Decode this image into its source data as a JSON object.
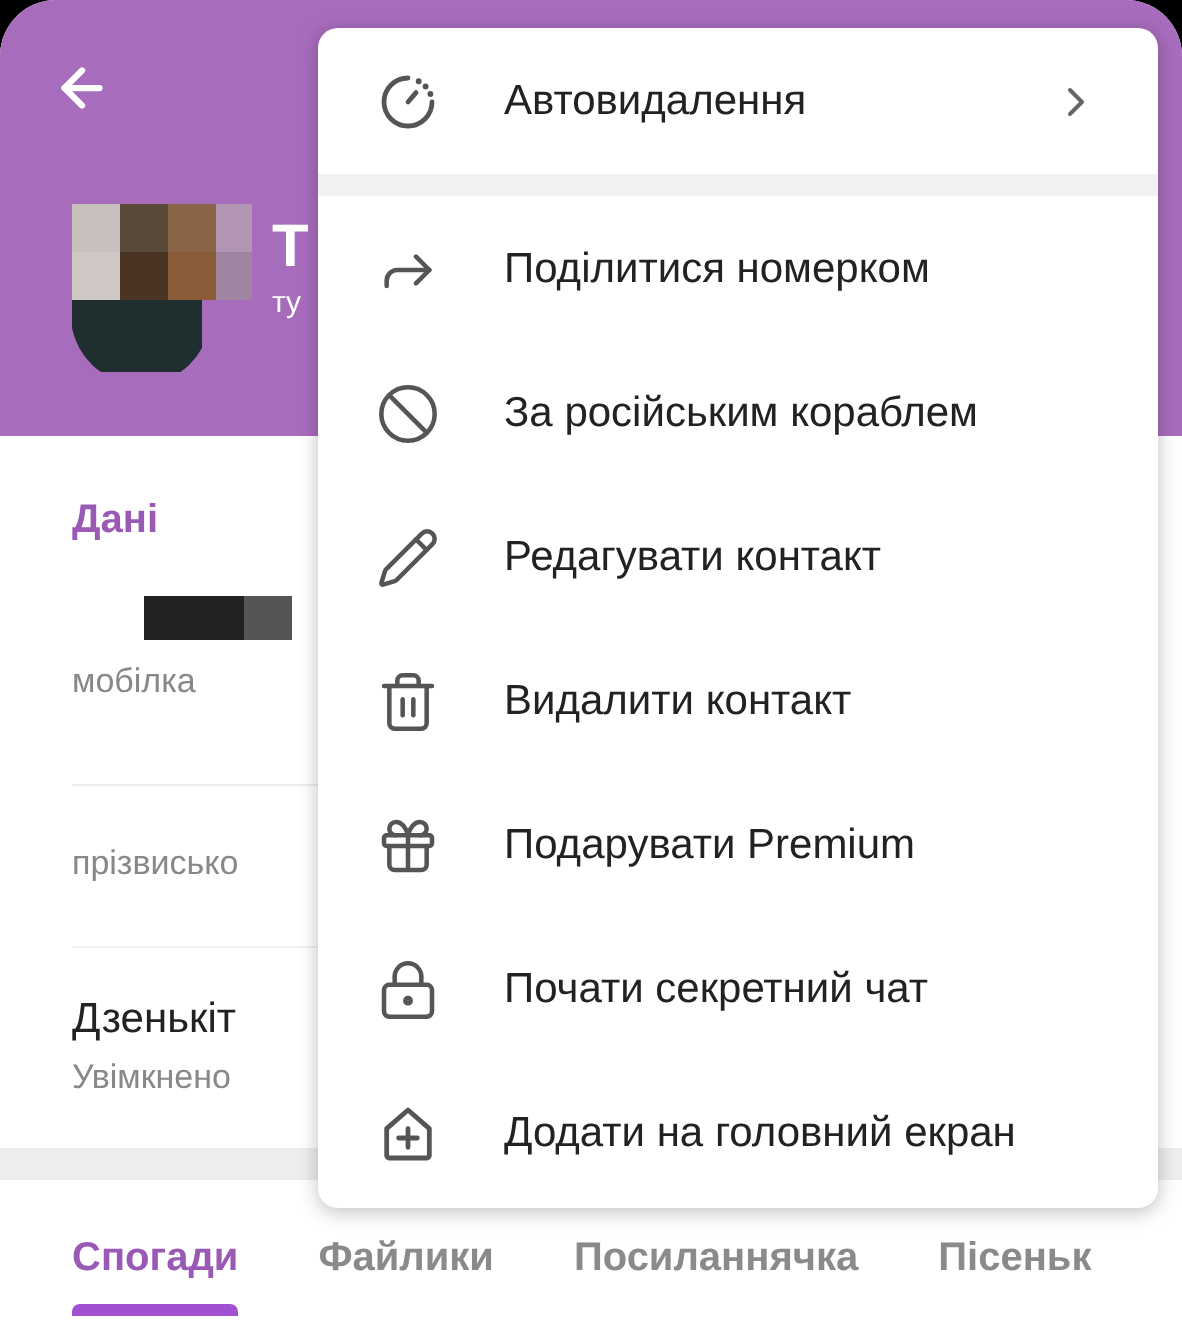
{
  "header": {
    "name": "Т",
    "subtitle": "ту"
  },
  "info": {
    "section_title": "Дані",
    "phone_label": "мобілка",
    "username_label": "прізвисько",
    "notifications": {
      "title": "Дзенькіт",
      "value": "Увімкнено"
    }
  },
  "tabs": [
    {
      "label": "Спогади",
      "selected": true
    },
    {
      "label": "Файлики",
      "selected": false
    },
    {
      "label": "Посиланнячка",
      "selected": false
    },
    {
      "label": "Пісеньк",
      "selected": false
    }
  ],
  "menu": {
    "top_item": {
      "label": "Автовидалення",
      "kind": "timer",
      "submenu": true
    },
    "items": [
      {
        "label": "Поділитися номерком",
        "kind": "share"
      },
      {
        "label": "За російським кораблем",
        "kind": "block"
      },
      {
        "label": "Редагувати контакт",
        "kind": "pencil"
      },
      {
        "label": "Видалити контакт",
        "kind": "trash"
      },
      {
        "label": "Подарувати Premium",
        "kind": "gift"
      },
      {
        "label": "Почати секретний чат",
        "kind": "lock"
      },
      {
        "label": "Додати на головний екран",
        "kind": "add-home"
      }
    ]
  }
}
